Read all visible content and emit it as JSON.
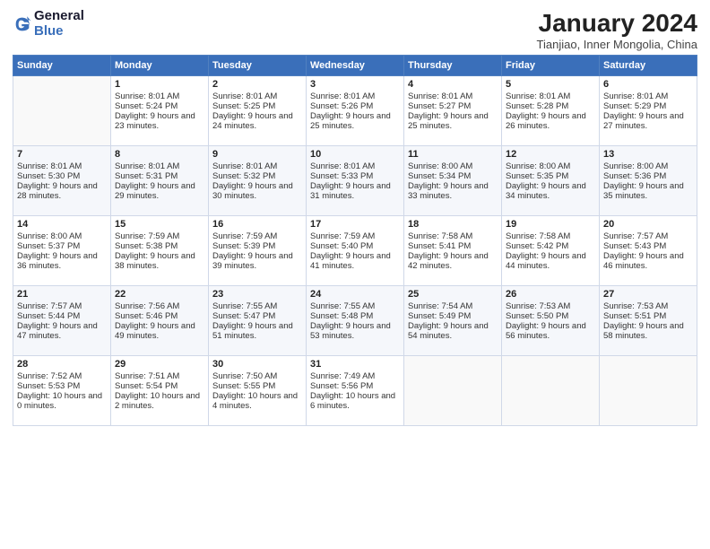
{
  "logo": {
    "line1": "General",
    "line2": "Blue"
  },
  "title": "January 2024",
  "location": "Tianjiao, Inner Mongolia, China",
  "days_of_week": [
    "Sunday",
    "Monday",
    "Tuesday",
    "Wednesday",
    "Thursday",
    "Friday",
    "Saturday"
  ],
  "weeks": [
    [
      {
        "day": "",
        "sunrise": "",
        "sunset": "",
        "daylight": ""
      },
      {
        "day": "1",
        "sunrise": "Sunrise: 8:01 AM",
        "sunset": "Sunset: 5:24 PM",
        "daylight": "Daylight: 9 hours and 23 minutes."
      },
      {
        "day": "2",
        "sunrise": "Sunrise: 8:01 AM",
        "sunset": "Sunset: 5:25 PM",
        "daylight": "Daylight: 9 hours and 24 minutes."
      },
      {
        "day": "3",
        "sunrise": "Sunrise: 8:01 AM",
        "sunset": "Sunset: 5:26 PM",
        "daylight": "Daylight: 9 hours and 25 minutes."
      },
      {
        "day": "4",
        "sunrise": "Sunrise: 8:01 AM",
        "sunset": "Sunset: 5:27 PM",
        "daylight": "Daylight: 9 hours and 25 minutes."
      },
      {
        "day": "5",
        "sunrise": "Sunrise: 8:01 AM",
        "sunset": "Sunset: 5:28 PM",
        "daylight": "Daylight: 9 hours and 26 minutes."
      },
      {
        "day": "6",
        "sunrise": "Sunrise: 8:01 AM",
        "sunset": "Sunset: 5:29 PM",
        "daylight": "Daylight: 9 hours and 27 minutes."
      }
    ],
    [
      {
        "day": "7",
        "sunrise": "Sunrise: 8:01 AM",
        "sunset": "Sunset: 5:30 PM",
        "daylight": "Daylight: 9 hours and 28 minutes."
      },
      {
        "day": "8",
        "sunrise": "Sunrise: 8:01 AM",
        "sunset": "Sunset: 5:31 PM",
        "daylight": "Daylight: 9 hours and 29 minutes."
      },
      {
        "day": "9",
        "sunrise": "Sunrise: 8:01 AM",
        "sunset": "Sunset: 5:32 PM",
        "daylight": "Daylight: 9 hours and 30 minutes."
      },
      {
        "day": "10",
        "sunrise": "Sunrise: 8:01 AM",
        "sunset": "Sunset: 5:33 PM",
        "daylight": "Daylight: 9 hours and 31 minutes."
      },
      {
        "day": "11",
        "sunrise": "Sunrise: 8:00 AM",
        "sunset": "Sunset: 5:34 PM",
        "daylight": "Daylight: 9 hours and 33 minutes."
      },
      {
        "day": "12",
        "sunrise": "Sunrise: 8:00 AM",
        "sunset": "Sunset: 5:35 PM",
        "daylight": "Daylight: 9 hours and 34 minutes."
      },
      {
        "day": "13",
        "sunrise": "Sunrise: 8:00 AM",
        "sunset": "Sunset: 5:36 PM",
        "daylight": "Daylight: 9 hours and 35 minutes."
      }
    ],
    [
      {
        "day": "14",
        "sunrise": "Sunrise: 8:00 AM",
        "sunset": "Sunset: 5:37 PM",
        "daylight": "Daylight: 9 hours and 36 minutes."
      },
      {
        "day": "15",
        "sunrise": "Sunrise: 7:59 AM",
        "sunset": "Sunset: 5:38 PM",
        "daylight": "Daylight: 9 hours and 38 minutes."
      },
      {
        "day": "16",
        "sunrise": "Sunrise: 7:59 AM",
        "sunset": "Sunset: 5:39 PM",
        "daylight": "Daylight: 9 hours and 39 minutes."
      },
      {
        "day": "17",
        "sunrise": "Sunrise: 7:59 AM",
        "sunset": "Sunset: 5:40 PM",
        "daylight": "Daylight: 9 hours and 41 minutes."
      },
      {
        "day": "18",
        "sunrise": "Sunrise: 7:58 AM",
        "sunset": "Sunset: 5:41 PM",
        "daylight": "Daylight: 9 hours and 42 minutes."
      },
      {
        "day": "19",
        "sunrise": "Sunrise: 7:58 AM",
        "sunset": "Sunset: 5:42 PM",
        "daylight": "Daylight: 9 hours and 44 minutes."
      },
      {
        "day": "20",
        "sunrise": "Sunrise: 7:57 AM",
        "sunset": "Sunset: 5:43 PM",
        "daylight": "Daylight: 9 hours and 46 minutes."
      }
    ],
    [
      {
        "day": "21",
        "sunrise": "Sunrise: 7:57 AM",
        "sunset": "Sunset: 5:44 PM",
        "daylight": "Daylight: 9 hours and 47 minutes."
      },
      {
        "day": "22",
        "sunrise": "Sunrise: 7:56 AM",
        "sunset": "Sunset: 5:46 PM",
        "daylight": "Daylight: 9 hours and 49 minutes."
      },
      {
        "day": "23",
        "sunrise": "Sunrise: 7:55 AM",
        "sunset": "Sunset: 5:47 PM",
        "daylight": "Daylight: 9 hours and 51 minutes."
      },
      {
        "day": "24",
        "sunrise": "Sunrise: 7:55 AM",
        "sunset": "Sunset: 5:48 PM",
        "daylight": "Daylight: 9 hours and 53 minutes."
      },
      {
        "day": "25",
        "sunrise": "Sunrise: 7:54 AM",
        "sunset": "Sunset: 5:49 PM",
        "daylight": "Daylight: 9 hours and 54 minutes."
      },
      {
        "day": "26",
        "sunrise": "Sunrise: 7:53 AM",
        "sunset": "Sunset: 5:50 PM",
        "daylight": "Daylight: 9 hours and 56 minutes."
      },
      {
        "day": "27",
        "sunrise": "Sunrise: 7:53 AM",
        "sunset": "Sunset: 5:51 PM",
        "daylight": "Daylight: 9 hours and 58 minutes."
      }
    ],
    [
      {
        "day": "28",
        "sunrise": "Sunrise: 7:52 AM",
        "sunset": "Sunset: 5:53 PM",
        "daylight": "Daylight: 10 hours and 0 minutes."
      },
      {
        "day": "29",
        "sunrise": "Sunrise: 7:51 AM",
        "sunset": "Sunset: 5:54 PM",
        "daylight": "Daylight: 10 hours and 2 minutes."
      },
      {
        "day": "30",
        "sunrise": "Sunrise: 7:50 AM",
        "sunset": "Sunset: 5:55 PM",
        "daylight": "Daylight: 10 hours and 4 minutes."
      },
      {
        "day": "31",
        "sunrise": "Sunrise: 7:49 AM",
        "sunset": "Sunset: 5:56 PM",
        "daylight": "Daylight: 10 hours and 6 minutes."
      },
      {
        "day": "",
        "sunrise": "",
        "sunset": "",
        "daylight": ""
      },
      {
        "day": "",
        "sunrise": "",
        "sunset": "",
        "daylight": ""
      },
      {
        "day": "",
        "sunrise": "",
        "sunset": "",
        "daylight": ""
      }
    ]
  ]
}
